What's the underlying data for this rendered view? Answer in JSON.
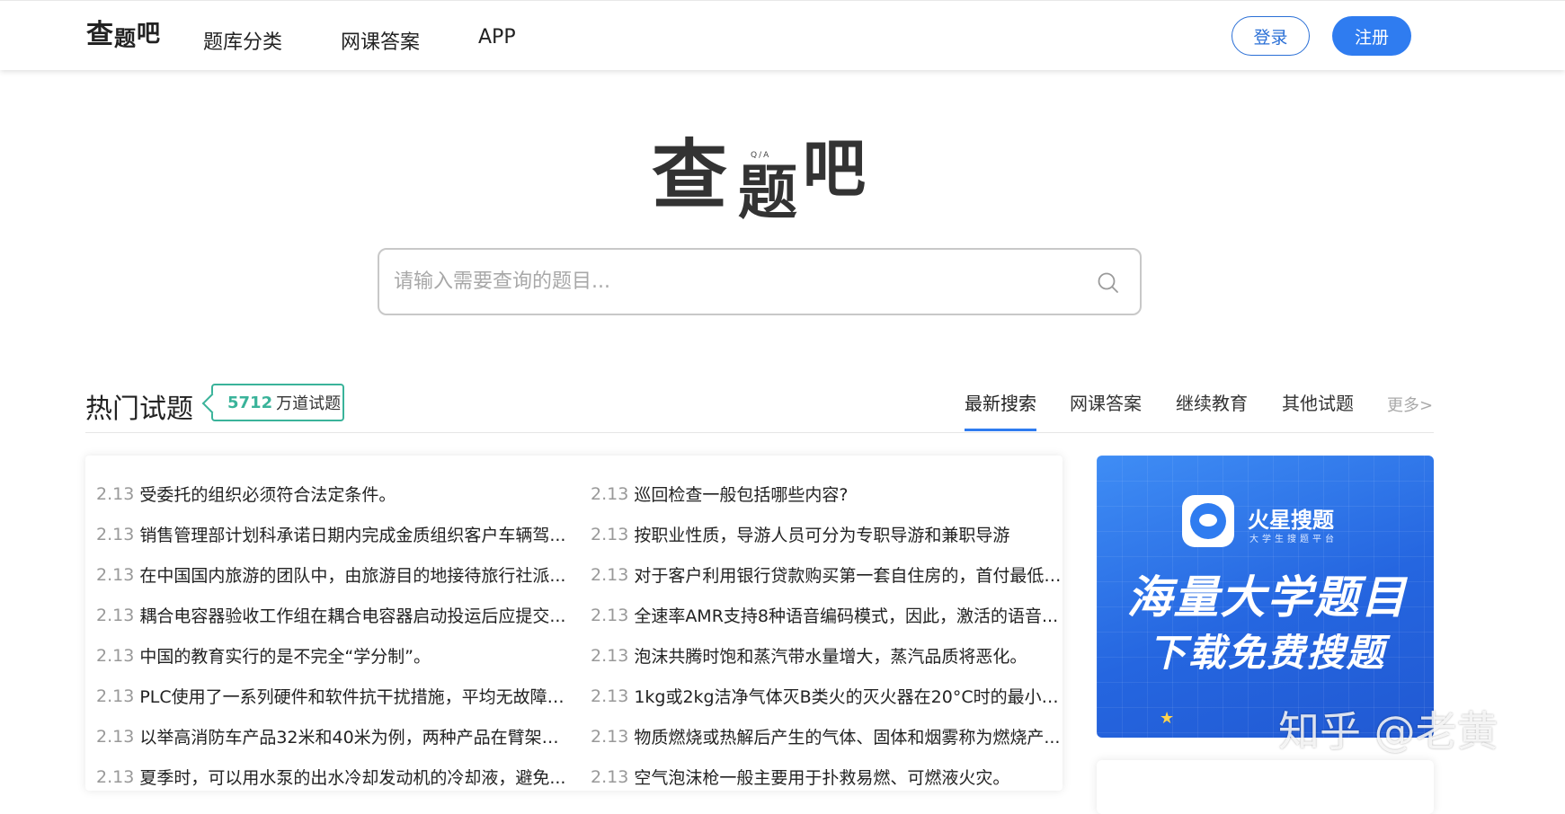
{
  "header": {
    "logo_chars": [
      "查",
      "题",
      "吧"
    ],
    "nav": [
      "题库分类",
      "网课答案",
      "APP"
    ],
    "login_label": "登录",
    "register_label": "注册"
  },
  "hero": {
    "logo_chars": [
      "查",
      "题",
      "吧"
    ],
    "logo_tag": "Q/A"
  },
  "search": {
    "placeholder": "请输入需要查询的题目..."
  },
  "section": {
    "title": "热门试题",
    "count_number": "5712",
    "count_suffix": "万道试题",
    "tabs": [
      "最新搜索",
      "网课答案",
      "继续教育",
      "其他试题"
    ],
    "more_label": "更多>"
  },
  "questions_left": [
    {
      "date": "2.13",
      "text": "受委托的组织必须符合法定条件。"
    },
    {
      "date": "2.13",
      "text": "销售管理部计划科承诺日期内完成金质组织客户车辆驾..."
    },
    {
      "date": "2.13",
      "text": "在中国国内旅游的团队中，由旅游目的地接待旅行社派..."
    },
    {
      "date": "2.13",
      "text": "耦合电容器验收工作组在耦合电容器启动投运后应提交..."
    },
    {
      "date": "2.13",
      "text": "中国的教育实行的是不完全“学分制”。"
    },
    {
      "date": "2.13",
      "text": "PLC使用了一系列硬件和软件抗干扰措施，平均无故障时..."
    },
    {
      "date": "2.13",
      "text": "以举高消防车产品32米和40米为例，两种产品在臂架和..."
    },
    {
      "date": "2.13",
      "text": "夏季时，可以用水泵的出水冷却发动机的冷却液，避免..."
    }
  ],
  "questions_right": [
    {
      "date": "2.13",
      "text": "巡回检查一般包括哪些内容?"
    },
    {
      "date": "2.13",
      "text": "按职业性质，导游人员可分为专职导游和兼职导游"
    },
    {
      "date": "2.13",
      "text": "对于客户利用银行贷款购买第一套自住房的，首付最低2..."
    },
    {
      "date": "2.13",
      "text": "全速率AMR支持8种语音编码模式，因此，激活的语音..."
    },
    {
      "date": "2.13",
      "text": "泡沫共腾时饱和蒸汽带水量增大，蒸汽品质将恶化。"
    },
    {
      "date": "2.13",
      "text": "1kg或2kg洁净气体灭B类火的灭火器在20°C时的最小有..."
    },
    {
      "date": "2.13",
      "text": "物质燃烧或热解后产生的气体、固体和烟雾称为燃烧产..."
    },
    {
      "date": "2.13",
      "text": "空气泡沫枪一般主要用于扑救易燃、可燃液火灾。"
    }
  ],
  "ad": {
    "app_name": "火星搜题",
    "app_sub": "大学生搜题平台",
    "line1": "海量大学题目",
    "line2": "下载免费搜题"
  },
  "watermark": "知乎 @老黄",
  "colors": {
    "accent_blue": "#2f7cf0",
    "badge_green": "#3ab39a"
  }
}
